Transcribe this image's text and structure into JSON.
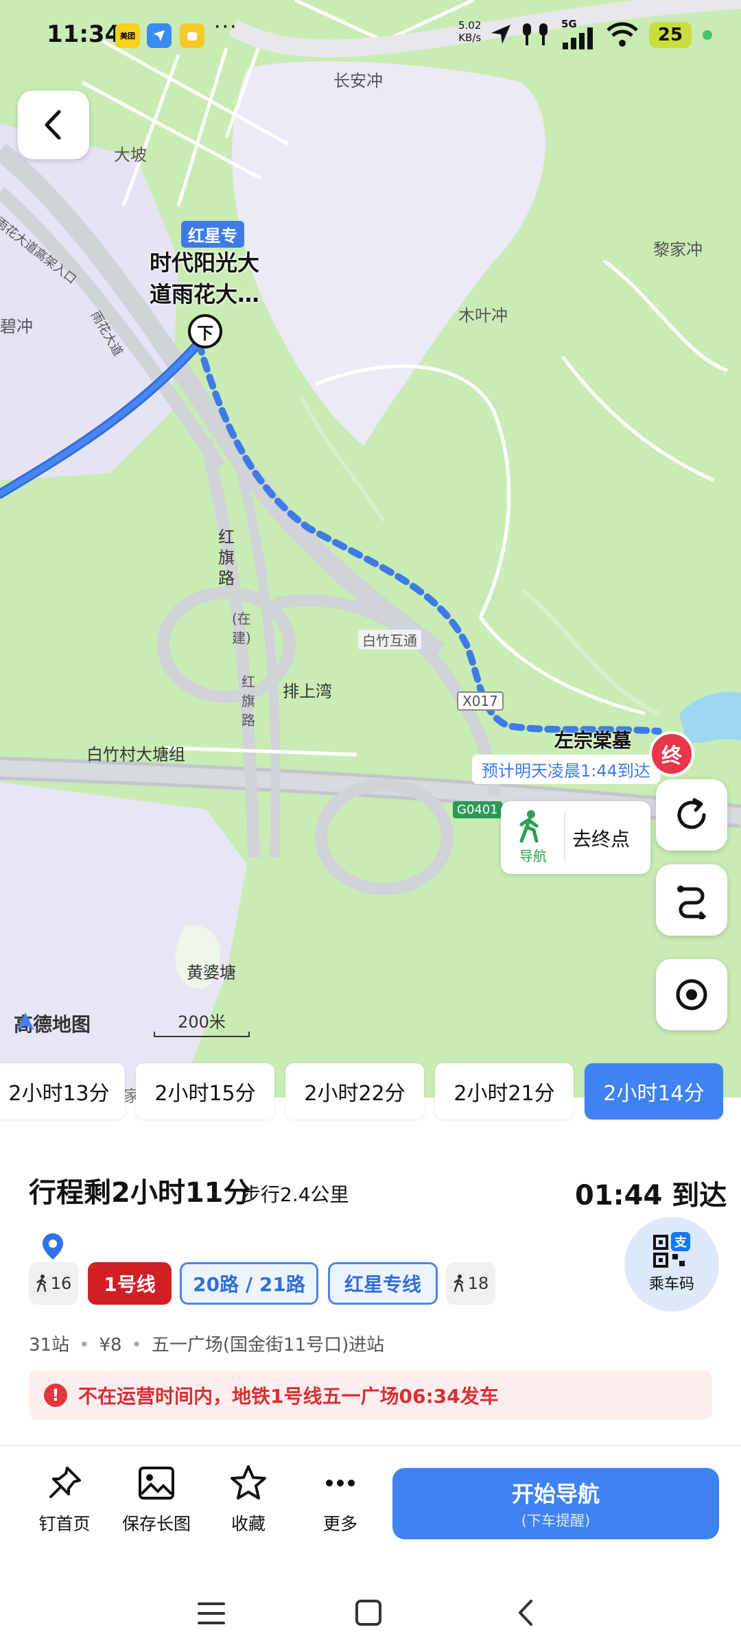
{
  "status_bar": {
    "time": "11:34",
    "app_icons": [
      "美团",
      "feishu",
      "notes"
    ],
    "more": "···",
    "net_speed_value": "5.02",
    "net_speed_unit": "KB/s",
    "network": "5G",
    "battery": "25"
  },
  "map": {
    "labels": {
      "changanchong": "长安冲",
      "dapo": "大坡",
      "lijiachong": "黎家冲",
      "muyechong": "木叶冲",
      "bichong": "碧冲",
      "yuhua_entry": "雨花大道高架入口",
      "yuhua_road": "雨花大道",
      "hongqi_road": "红旗路",
      "zaijian": "(在建)",
      "hongqi_road2": "红旗路",
      "baizhu_interchange": "白竹互通",
      "paishangwan": "排上湾",
      "x017": "X017",
      "baizhu_village": "白竹村大塘组",
      "g0401": "G0401",
      "huangpotang": "黄婆塘",
      "jia": "家"
    },
    "stop_tag": "红星专",
    "stop_name_line1": "时代阳光大",
    "stop_name_line2": "道雨花大…",
    "alight_marker": "下",
    "destination_name": "左宗棠墓",
    "eta_text": "预计明天凌晨1:44到达",
    "end_marker": "终",
    "walk_nav_label": "导航",
    "goto_end": "去终点",
    "logo_text": "高德地图",
    "scale_text": "200米"
  },
  "time_options": [
    {
      "label": "2小时13分",
      "active": false
    },
    {
      "label": "2小时15分",
      "active": false
    },
    {
      "label": "2小时22分",
      "active": false
    },
    {
      "label": "2小时21分",
      "active": false
    },
    {
      "label": "2小时14分",
      "active": true
    }
  ],
  "trip": {
    "remaining": "行程剩2小时11分",
    "walk_distance": "步行2.4公里",
    "arrival": "01:44 到达",
    "segments": {
      "walk_start": "16",
      "metro": "1号线",
      "bus": "20路 / 21路",
      "special": "红星专线",
      "walk_end": "18"
    },
    "qr_label": "乘车码",
    "qr_badge": "支",
    "stations": "31站",
    "fare": "¥8",
    "entry": "五一广场(国金街11号口)进站",
    "warning": "不在运营时间内，地铁1号线五一广场06:34发车"
  },
  "actions": {
    "pin": "钉首页",
    "save": "保存长图",
    "fav": "收藏",
    "more": "更多",
    "start": "开始导航",
    "start_sub": "(下车提醒)"
  },
  "colors": {
    "accent": "#3f82f2",
    "route": "#3f7be6",
    "metro": "#d11f26",
    "warning": "#d92e35",
    "map_bg": "#c9ecb4"
  }
}
